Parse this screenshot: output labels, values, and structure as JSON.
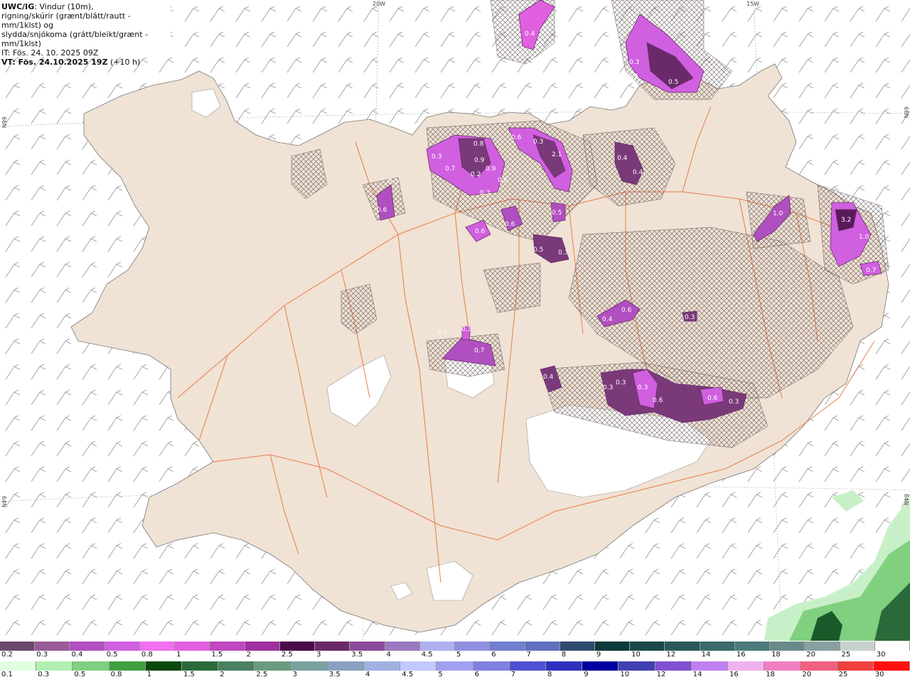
{
  "info": {
    "model": "UWC/IG",
    "line1_rest": ": Vindur (10m),",
    "line2": "rigning/skúrir (grænt/blátt/rautt - mm/1klst) og",
    "line3": "slydda/snjókoma (grátt/bleikt/grænt - mm/1klst)",
    "it": "IT: Fös. 24. 10. 2025 09Z",
    "vt_bold": "VT: Fös. 24.10.2025 19Z",
    "vt_rest": " (+10 h)"
  },
  "grid_labels": {
    "lon_20w": "20W",
    "lon_15w": "15W",
    "lat_66n_left": "66N",
    "lat_66n_right": "66N",
    "lat_64n_left": "64N",
    "lat_64n_right": "64N"
  },
  "colors": {
    "land": "#f0e2d4",
    "sea": "#ffffff",
    "glacier": "#ffffff",
    "roads": "#e8703a",
    "snow_light": "#f070f0",
    "snow_mid": "#b040b0",
    "snow_dark": "#5a2a5a",
    "rain_light": "#c8f0c8",
    "rain_dark": "#1a5a2a"
  },
  "snow_labels": [
    "0.4",
    "0.3",
    "0.5",
    "0.5",
    "0.4",
    "0.4",
    "0.3",
    "0.8",
    "0.9",
    "0.7",
    "0.2",
    "0.9",
    "0.3",
    "0.6",
    "0.3",
    "0.6",
    "0.6",
    "0.6",
    "0.6",
    "0.3",
    "2.1",
    "0.5",
    "0.5",
    "0.3",
    "1.0",
    "3.2",
    "1.0",
    "0.7",
    "0.6",
    "0.4",
    "0.3",
    "0.5",
    "0.7",
    "0.3",
    "0.4",
    "0.3",
    "0.3",
    "0.3",
    "0.6",
    "0.6",
    "0.3",
    "0.5"
  ],
  "scale_snow": {
    "colors": [
      "#6a4a6a",
      "#9a5a9a",
      "#b050c0",
      "#d060e0",
      "#f070f0",
      "#e060e0",
      "#c048c0",
      "#a030a0",
      "#4a0a4a",
      "#6a2a6a",
      "#8a4a9a",
      "#9a7ac0",
      "#b0b0f0",
      "#9090e0",
      "#7080d0",
      "#6070c0",
      "#304a70",
      "#0a3a3a",
      "#1a4a4a",
      "#2a5a5a",
      "#3a6a6a",
      "#4a7a7a",
      "#6a8a8a",
      "#8aa0a0",
      "#c8d0d0",
      "#ffffff"
    ],
    "labels": [
      "0.2",
      "0.3",
      "0.4",
      "0.5",
      "0.8",
      "1",
      "1.5",
      "2",
      "2.5",
      "3",
      "3.5",
      "4",
      "4.5",
      "5",
      "6",
      "7",
      "8",
      "9",
      "10",
      "12",
      "14",
      "16",
      "18",
      "20",
      "25",
      "30"
    ]
  },
  "scale_rain": {
    "colors": [
      "#e0ffe0",
      "#b0f0b0",
      "#80d080",
      "#40a040",
      "#0a4a0a",
      "#2a6a3a",
      "#4a8060",
      "#6a9a80",
      "#7aa0a0",
      "#8aa0c0",
      "#a0b0e0",
      "#c0c8ff",
      "#a0a0f0",
      "#8080e0",
      "#5050d0",
      "#3030c0",
      "#0000a0",
      "#4040b0",
      "#8050d0",
      "#c080f0",
      "#f0b0f0",
      "#f080c0",
      "#f06080",
      "#f04040",
      "#ff1010"
    ],
    "labels": [
      "0.1",
      "0.3",
      "0.5",
      "0.8",
      "1",
      "1.5",
      "2",
      "2.5",
      "3",
      "3.5",
      "4",
      "4.5",
      "5",
      "6",
      "7",
      "8",
      "9",
      "10",
      "12",
      "14",
      "16",
      "18",
      "20",
      "25",
      "30"
    ]
  }
}
